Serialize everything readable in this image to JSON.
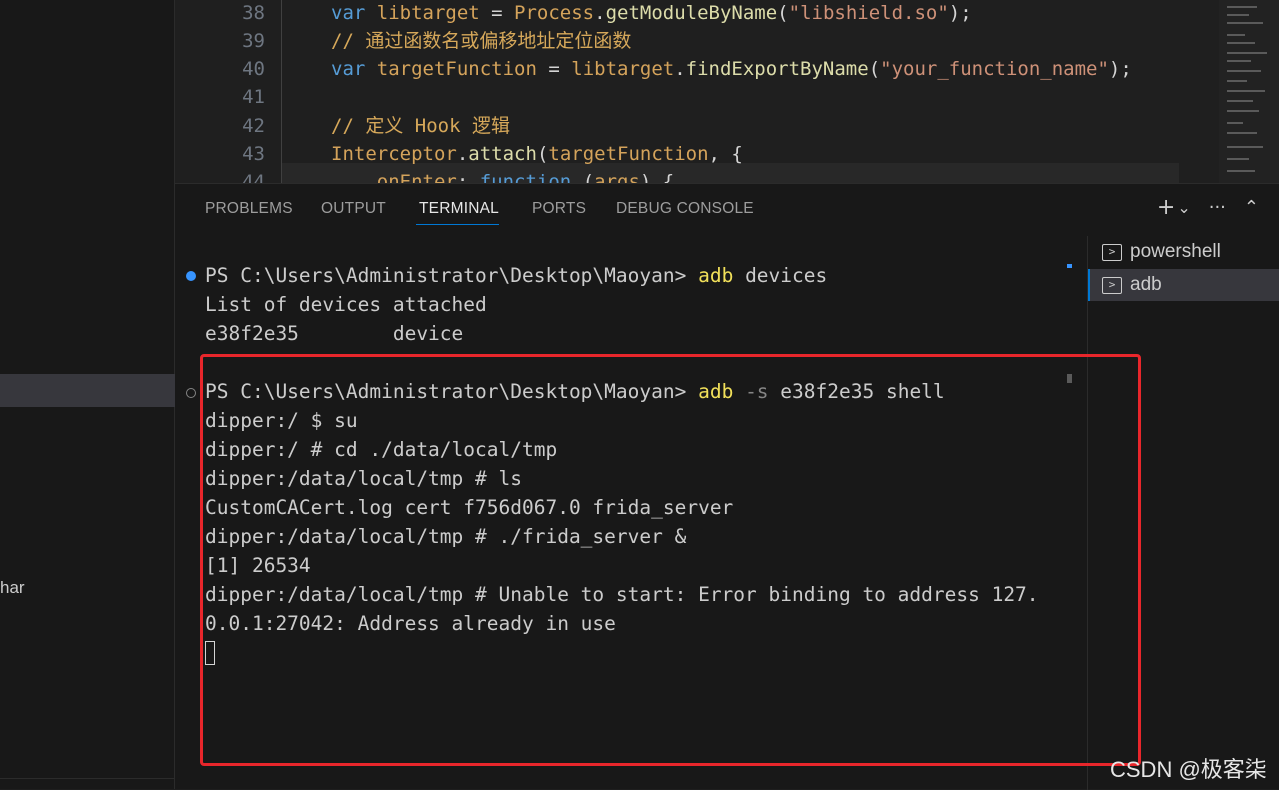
{
  "sidebar": {
    "fragment": "har"
  },
  "editor": {
    "line_numbers": [
      "38",
      "39",
      "40",
      "41",
      "42",
      "43",
      "44"
    ],
    "lines": [
      [
        {
          "t": "var ",
          "c": "kw"
        },
        {
          "t": "libtarget",
          "c": "var"
        },
        {
          "t": " = ",
          "c": "plain"
        },
        {
          "t": "Process",
          "c": "var"
        },
        {
          "t": ".",
          "c": "plain"
        },
        {
          "t": "getModuleByName",
          "c": "fn"
        },
        {
          "t": "(",
          "c": "plain"
        },
        {
          "t": "\"libshield.so\"",
          "c": "str"
        },
        {
          "t": ");",
          "c": "plain"
        }
      ],
      [
        {
          "t": "// 通过函数名或偏移地址定位函数",
          "c": "cmt"
        }
      ],
      [
        {
          "t": "var ",
          "c": "kw"
        },
        {
          "t": "targetFunction",
          "c": "var"
        },
        {
          "t": " = ",
          "c": "plain"
        },
        {
          "t": "libtarget",
          "c": "var"
        },
        {
          "t": ".",
          "c": "plain"
        },
        {
          "t": "findExportByName",
          "c": "fn"
        },
        {
          "t": "(",
          "c": "plain"
        },
        {
          "t": "\"your_function_name\"",
          "c": "str"
        },
        {
          "t": ");",
          "c": "plain"
        }
      ],
      [],
      [
        {
          "t": "// 定义 Hook 逻辑",
          "c": "cmt"
        }
      ],
      [
        {
          "t": "Interceptor",
          "c": "var"
        },
        {
          "t": ".",
          "c": "plain"
        },
        {
          "t": "attach",
          "c": "fn"
        },
        {
          "t": "(",
          "c": "plain"
        },
        {
          "t": "targetFunction",
          "c": "var"
        },
        {
          "t": ", {",
          "c": "plain"
        }
      ],
      [
        {
          "t": "    onEnter",
          "c": "var"
        },
        {
          "t": ": ",
          "c": "plain"
        },
        {
          "t": "function",
          "c": "kw"
        },
        {
          "t": " (",
          "c": "plain"
        },
        {
          "t": "args",
          "c": "var"
        },
        {
          "t": ") {",
          "c": "plain"
        }
      ]
    ]
  },
  "panel": {
    "tabs": [
      "PROBLEMS",
      "OUTPUT",
      "TERMINAL",
      "PORTS",
      "DEBUG CONSOLE"
    ],
    "active_tab": "TERMINAL",
    "actions": {
      "new": "+",
      "dropdown": "⌄",
      "more": "···",
      "collapse": "⌃"
    }
  },
  "terminal": {
    "cmd1": {
      "prompt": "PS C:\\Users\\Administrator\\Desktop\\Maoyan> ",
      "command": "adb",
      "args": " devices"
    },
    "out1": [
      "List of devices attached",
      "e38f2e35        device"
    ],
    "cmd2": {
      "prompt": "PS C:\\Users\\Administrator\\Desktop\\Maoyan> ",
      "command": "adb",
      "flag": " -s",
      "args": " e38f2e35 shell"
    },
    "out2": [
      "dipper:/ $ su",
      "dipper:/ # cd ./data/local/tmp",
      "dipper:/data/local/tmp # ls",
      "CustomCACert.log cert f756d067.0 frida_server",
      "dipper:/data/local/tmp # ./frida_server &",
      "[1] 26534",
      "dipper:/data/local/tmp # Unable to start: Error binding to address 127.",
      "0.0.1:27042: Address already in use"
    ]
  },
  "terminal_list": [
    {
      "label": "powershell",
      "selected": false
    },
    {
      "label": "adb",
      "selected": true
    }
  ],
  "watermark": "CSDN @极客柒",
  "colors": {
    "annotation_box": "#e8262b",
    "accent": "#0078d4",
    "command": "#f1e05a"
  }
}
